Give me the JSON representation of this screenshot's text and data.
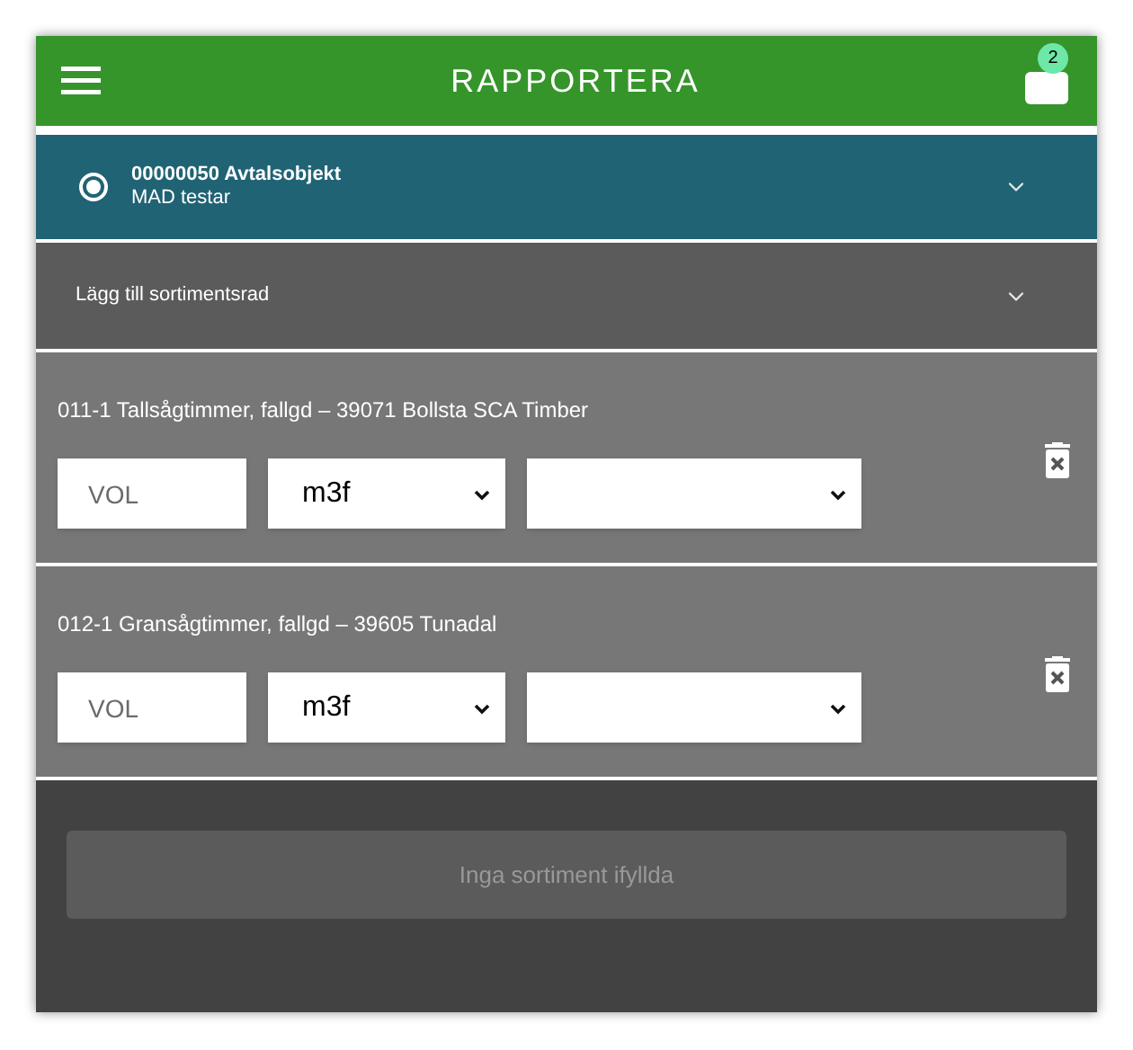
{
  "header": {
    "title": "RAPPORTERA",
    "badge": "2"
  },
  "contract": {
    "selected": true,
    "title": "00000050 Avtalsobjekt",
    "subtitle": "MAD testar",
    "expanded": false
  },
  "add_row": {
    "label": "Lägg till sortimentsrad",
    "expanded": false
  },
  "rows": [
    {
      "title": "011-1 Tallsågtimmer, fallgd – 39071 Bollsta SCA Timber",
      "volume": {
        "placeholder": "VOL"
      },
      "unit": "m3f",
      "option": ""
    },
    {
      "title": "012-1 Gransågtimmer, fallgd – 39605 Tunadal",
      "volume": {
        "placeholder": "VOL"
      },
      "unit": "m3f",
      "option": ""
    }
  ],
  "submit": {
    "label": "Inga sortiment ifyllda",
    "disabled": true
  }
}
